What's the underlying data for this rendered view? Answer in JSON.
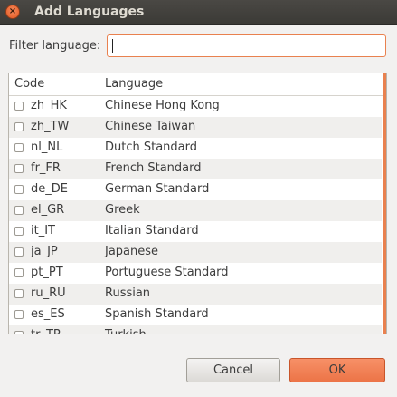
{
  "window": {
    "title": "Add Languages",
    "close_glyph": "×"
  },
  "filter": {
    "label": "Filter language:",
    "value": "",
    "placeholder": ""
  },
  "table": {
    "columns": [
      "Code",
      "Language"
    ],
    "rows": [
      {
        "code": "zh_HK",
        "language": "Chinese Hong Kong"
      },
      {
        "code": "zh_TW",
        "language": "Chinese Taiwan"
      },
      {
        "code": "nl_NL",
        "language": "Dutch Standard"
      },
      {
        "code": "fr_FR",
        "language": "French Standard"
      },
      {
        "code": "de_DE",
        "language": "German Standard"
      },
      {
        "code": "el_GR",
        "language": "Greek"
      },
      {
        "code": "it_IT",
        "language": "Italian Standard"
      },
      {
        "code": "ja_JP",
        "language": "Japanese"
      },
      {
        "code": "pt_PT",
        "language": "Portuguese Standard"
      },
      {
        "code": "ru_RU",
        "language": "Russian"
      },
      {
        "code": "es_ES",
        "language": "Spanish Standard"
      },
      {
        "code": "tr_TR",
        "language": "Turkish"
      }
    ]
  },
  "buttons": {
    "cancel": "Cancel",
    "ok": "OK"
  },
  "colors": {
    "accent": "#e9814f",
    "titlebar": "#3c3b37"
  }
}
